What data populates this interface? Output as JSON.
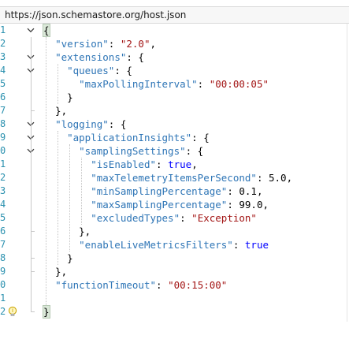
{
  "address_bar": {
    "url": "https://json.schemastore.org/host.json"
  },
  "editor": {
    "lines": [
      {
        "num": "1",
        "fold": "open",
        "tokens": [
          {
            "t": "{",
            "c": "p hl"
          }
        ]
      },
      {
        "num": "2",
        "fold": "none",
        "tokens": [
          {
            "t": "  ",
            "c": "p"
          },
          {
            "t": "\"version\"",
            "c": "k"
          },
          {
            "t": ": ",
            "c": "p"
          },
          {
            "t": "\"2.0\"",
            "c": "s"
          },
          {
            "t": ",",
            "c": "p"
          }
        ]
      },
      {
        "num": "3",
        "fold": "open",
        "tokens": [
          {
            "t": "  ",
            "c": "p"
          },
          {
            "t": "\"extensions\"",
            "c": "k"
          },
          {
            "t": ": {",
            "c": "p"
          }
        ]
      },
      {
        "num": "4",
        "fold": "open",
        "tokens": [
          {
            "t": "    ",
            "c": "p"
          },
          {
            "t": "\"queues\"",
            "c": "k"
          },
          {
            "t": ": {",
            "c": "p"
          }
        ]
      },
      {
        "num": "5",
        "fold": "none",
        "tokens": [
          {
            "t": "      ",
            "c": "p"
          },
          {
            "t": "\"maxPollingInterval\"",
            "c": "k"
          },
          {
            "t": ": ",
            "c": "p"
          },
          {
            "t": "\"00:00:05\"",
            "c": "s"
          }
        ]
      },
      {
        "num": "6",
        "fold": "none",
        "tokens": [
          {
            "t": "    }",
            "c": "p"
          }
        ]
      },
      {
        "num": "7",
        "fold": "none",
        "tokens": [
          {
            "t": "  },",
            "c": "p"
          }
        ]
      },
      {
        "num": "8",
        "fold": "open",
        "tokens": [
          {
            "t": "  ",
            "c": "p"
          },
          {
            "t": "\"logging\"",
            "c": "k"
          },
          {
            "t": ": {",
            "c": "p"
          }
        ]
      },
      {
        "num": "9",
        "fold": "open",
        "tokens": [
          {
            "t": "    ",
            "c": "p"
          },
          {
            "t": "\"applicationInsights\"",
            "c": "k"
          },
          {
            "t": ": {",
            "c": "p"
          }
        ]
      },
      {
        "num": "0",
        "fold": "open",
        "tokens": [
          {
            "t": "      ",
            "c": "p"
          },
          {
            "t": "\"samplingSettings\"",
            "c": "k"
          },
          {
            "t": ": {",
            "c": "p"
          }
        ]
      },
      {
        "num": "1",
        "fold": "none",
        "tokens": [
          {
            "t": "        ",
            "c": "p"
          },
          {
            "t": "\"isEnabled\"",
            "c": "k"
          },
          {
            "t": ": ",
            "c": "p"
          },
          {
            "t": "true",
            "c": "b"
          },
          {
            "t": ",",
            "c": "p"
          }
        ]
      },
      {
        "num": "2",
        "fold": "none",
        "tokens": [
          {
            "t": "        ",
            "c": "p"
          },
          {
            "t": "\"maxTelemetryItemsPerSecond\"",
            "c": "k"
          },
          {
            "t": ": ",
            "c": "p"
          },
          {
            "t": "5.0",
            "c": "n"
          },
          {
            "t": ",",
            "c": "p"
          }
        ]
      },
      {
        "num": "3",
        "fold": "none",
        "tokens": [
          {
            "t": "        ",
            "c": "p"
          },
          {
            "t": "\"minSamplingPercentage\"",
            "c": "k"
          },
          {
            "t": ": ",
            "c": "p"
          },
          {
            "t": "0.1",
            "c": "n"
          },
          {
            "t": ",",
            "c": "p"
          }
        ]
      },
      {
        "num": "4",
        "fold": "none",
        "tokens": [
          {
            "t": "        ",
            "c": "p"
          },
          {
            "t": "\"maxSamplingPercentage\"",
            "c": "k"
          },
          {
            "t": ": ",
            "c": "p"
          },
          {
            "t": "99.0",
            "c": "n"
          },
          {
            "t": ",",
            "c": "p"
          }
        ]
      },
      {
        "num": "5",
        "fold": "none",
        "tokens": [
          {
            "t": "        ",
            "c": "p"
          },
          {
            "t": "\"excludedTypes\"",
            "c": "k"
          },
          {
            "t": ": ",
            "c": "p"
          },
          {
            "t": "\"Exception\"",
            "c": "s"
          }
        ]
      },
      {
        "num": "6",
        "fold": "none",
        "tokens": [
          {
            "t": "      },",
            "c": "p"
          }
        ]
      },
      {
        "num": "7",
        "fold": "none",
        "tokens": [
          {
            "t": "      ",
            "c": "p"
          },
          {
            "t": "\"enableLiveMetricsFilters\"",
            "c": "k"
          },
          {
            "t": ": ",
            "c": "p"
          },
          {
            "t": "true",
            "c": "b"
          }
        ]
      },
      {
        "num": "8",
        "fold": "none",
        "tokens": [
          {
            "t": "    }",
            "c": "p"
          }
        ]
      },
      {
        "num": "9",
        "fold": "none",
        "tokens": [
          {
            "t": "  },",
            "c": "p"
          }
        ]
      },
      {
        "num": "0",
        "fold": "none",
        "tokens": [
          {
            "t": "  ",
            "c": "p"
          },
          {
            "t": "\"functionTimeout\"",
            "c": "k"
          },
          {
            "t": ": ",
            "c": "p"
          },
          {
            "t": "\"00:15:00\"",
            "c": "s"
          }
        ]
      },
      {
        "num": "1",
        "fold": "none",
        "tokens": []
      },
      {
        "num": "2",
        "fold": "none",
        "bulb": true,
        "tokens": [
          {
            "t": "}",
            "c": "p hl"
          }
        ]
      }
    ]
  },
  "colors": {
    "property_key": "#2e75b6",
    "string_value": "#a31515",
    "keyword": "#0000ff",
    "line_number": "#2b91af",
    "brace_highlight": "#dbe9d9"
  },
  "icons": {
    "fold_open": "chevron-down-icon",
    "quick_actions": "lightbulb-icon"
  }
}
